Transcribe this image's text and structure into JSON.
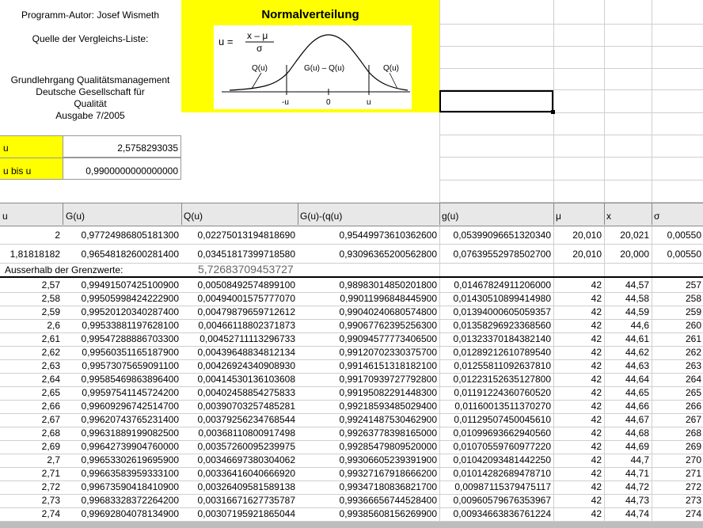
{
  "info": {
    "author": "Programm-Autor: Josef Wismeth",
    "source_label": "Quelle der Vergleichs-Liste:",
    "source_line1": "Grundlehrgang Qualitätsmanagement",
    "source_line2": "Deutsche Gesellschaft für",
    "source_line3": "Qualität",
    "source_line4": "Ausgabe 7/2005"
  },
  "banner": {
    "title": "Normalverteilung",
    "formula_u": "u =",
    "formula_num": "x – μ",
    "formula_den": "σ",
    "label_q_left": "Q(u)",
    "label_mid": "G(u) – Q(u)",
    "label_q_right": "Q(u)",
    "axis_neg_u": "-u",
    "axis_zero": "0",
    "axis_u": "u"
  },
  "inputs": {
    "u_label": "u",
    "u_value": "2,5758293035",
    "ubis_label": "u bis u",
    "ubis_value": "0,9900000000000000"
  },
  "columns": [
    "u",
    "G(u)",
    "Q(u)",
    "G(u)-(q(u)",
    "g(u)",
    "μ",
    "x",
    "σ"
  ],
  "summary_rows": [
    {
      "u": "2",
      "G": "0,97724986805181300",
      "Q": "0,02275013194818690",
      "GQ": "0,95449973610362600",
      "g": "0,05399096651320340",
      "mu": "20,010",
      "x": "20,021",
      "s": "0,00550"
    },
    {
      "u": "1,81818182",
      "G": "0,96548182600281400",
      "Q": "0,03451817399718580",
      "GQ": "0,93096365200562800",
      "g": "0,07639552978502700",
      "mu": "20,010",
      "x": "20,000",
      "s": "0,00550"
    }
  ],
  "outside": {
    "label": "Ausserhalb der Grenzwerte:",
    "value": "5,72683709453727"
  },
  "table": [
    {
      "u": "2,57",
      "G": "0,99491507425100900",
      "Q": "0,00508492574899100",
      "GQ": "0,98983014850201800",
      "g": "0,01467824911206000",
      "mu": "42",
      "x": "44,57",
      "s": "257"
    },
    {
      "u": "2,58",
      "G": "0,99505998424222900",
      "Q": "0,00494001575777070",
      "GQ": "0,99011996848445900",
      "g": "0,01430510899414980",
      "mu": "42",
      "x": "44,58",
      "s": "258"
    },
    {
      "u": "2,59",
      "G": "0,99520120340287400",
      "Q": "0,00479879659712612",
      "GQ": "0,99040240680574800",
      "g": "0,01394000605059357",
      "mu": "42",
      "x": "44,59",
      "s": "259"
    },
    {
      "u": "2,6",
      "G": "0,99533881197628100",
      "Q": "0,00466118802371873",
      "GQ": "0,99067762395256300",
      "g": "0,01358296923368560",
      "mu": "42",
      "x": "44,6",
      "s": "260"
    },
    {
      "u": "2,61",
      "G": "0,99547288886703300",
      "Q": "0,00452711113296733",
      "GQ": "0,99094577773406500",
      "g": "0,01323370184382140",
      "mu": "42",
      "x": "44,61",
      "s": "261"
    },
    {
      "u": "2,62",
      "G": "0,99560351165187900",
      "Q": "0,00439648834812134",
      "GQ": "0,99120702330375700",
      "g": "0,01289212610789540",
      "mu": "42",
      "x": "44,62",
      "s": "262"
    },
    {
      "u": "2,63",
      "G": "0,99573075659091100",
      "Q": "0,00426924340908930",
      "GQ": "0,99146151318182100",
      "g": "0,01255811092637810",
      "mu": "42",
      "x": "44,63",
      "s": "263"
    },
    {
      "u": "2,64",
      "G": "0,99585469863896400",
      "Q": "0,00414530136103608",
      "GQ": "0,99170939727792800",
      "g": "0,01223152635127800",
      "mu": "42",
      "x": "44,64",
      "s": "264"
    },
    {
      "u": "2,65",
      "G": "0,99597541145724200",
      "Q": "0,00402458854275833",
      "GQ": "0,99195082291448300",
      "g": "0,01191224360760520",
      "mu": "42",
      "x": "44,65",
      "s": "265"
    },
    {
      "u": "2,66",
      "G": "0,99609296742514700",
      "Q": "0,00390703257485281",
      "GQ": "0,99218593485029400",
      "g": "0,01160013511370270",
      "mu": "42",
      "x": "44,66",
      "s": "266"
    },
    {
      "u": "2,67",
      "G": "0,99620743765231400",
      "Q": "0,00379256234768544",
      "GQ": "0,99241487530462900",
      "g": "0,01129507450045610",
      "mu": "42",
      "x": "44,67",
      "s": "267"
    },
    {
      "u": "2,68",
      "G": "0,99631889199082500",
      "Q": "0,00368110800917498",
      "GQ": "0,99263778398165000",
      "g": "0,01099693662940560",
      "mu": "42",
      "x": "44,68",
      "s": "268"
    },
    {
      "u": "2,69",
      "G": "0,99642739904760000",
      "Q": "0,00357260095239975",
      "GQ": "0,99285479809520000",
      "g": "0,01070559760977220",
      "mu": "42",
      "x": "44,69",
      "s": "269"
    },
    {
      "u": "2,7",
      "G": "0,99653302619695900",
      "Q": "0,00346697380304062",
      "GQ": "0,99306605239391900",
      "g": "0,01042093481442250",
      "mu": "42",
      "x": "44,7",
      "s": "270"
    },
    {
      "u": "2,71",
      "G": "0,99663583959333100",
      "Q": "0,00336416040666920",
      "GQ": "0,99327167918666200",
      "g": "0,01014282689478710",
      "mu": "42",
      "x": "44,71",
      "s": "271"
    },
    {
      "u": "2,72",
      "G": "0,99673590418410900",
      "Q": "0,00326409581589138",
      "GQ": "0,99347180836821700",
      "g": "0,00987115379475117",
      "mu": "42",
      "x": "44,72",
      "s": "272"
    },
    {
      "u": "2,73",
      "G": "0,99683328372264200",
      "Q": "0,00316671627735787",
      "GQ": "0,99366656744528400",
      "g": "0,00960579676353967",
      "mu": "42",
      "x": "44,73",
      "s": "273"
    },
    {
      "u": "2,74",
      "G": "0,99692804078134900",
      "Q": "0,00307195921865044",
      "GQ": "0,99385608156269900",
      "g": "0,00934663836761224",
      "mu": "42",
      "x": "44,74",
      "s": "274"
    }
  ]
}
